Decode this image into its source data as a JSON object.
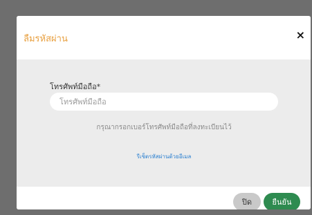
{
  "dialog": {
    "title": "ลืมรหัสผ่าน",
    "close_icon": "×"
  },
  "form": {
    "phone_label": "โทรศัพท์มือถือ*",
    "phone_placeholder": "โทรศัพท์มือถือ",
    "phone_value": "",
    "help_text": "กรุณากรอกเบอร์โทรศัพท์มือถือที่ลงทะเบียนไว้",
    "email_reset_link": "รีเซ็ตรหัสผ่านด้วยอีเมล"
  },
  "footer": {
    "close_label": "ปิด",
    "confirm_label": "ยืนยัน"
  },
  "colors": {
    "title": "#e8a040",
    "confirm_button": "#2e8b50",
    "close_button": "#c9c9c9",
    "link": "#2a7fd0",
    "overlay": "#6e6e6e"
  }
}
